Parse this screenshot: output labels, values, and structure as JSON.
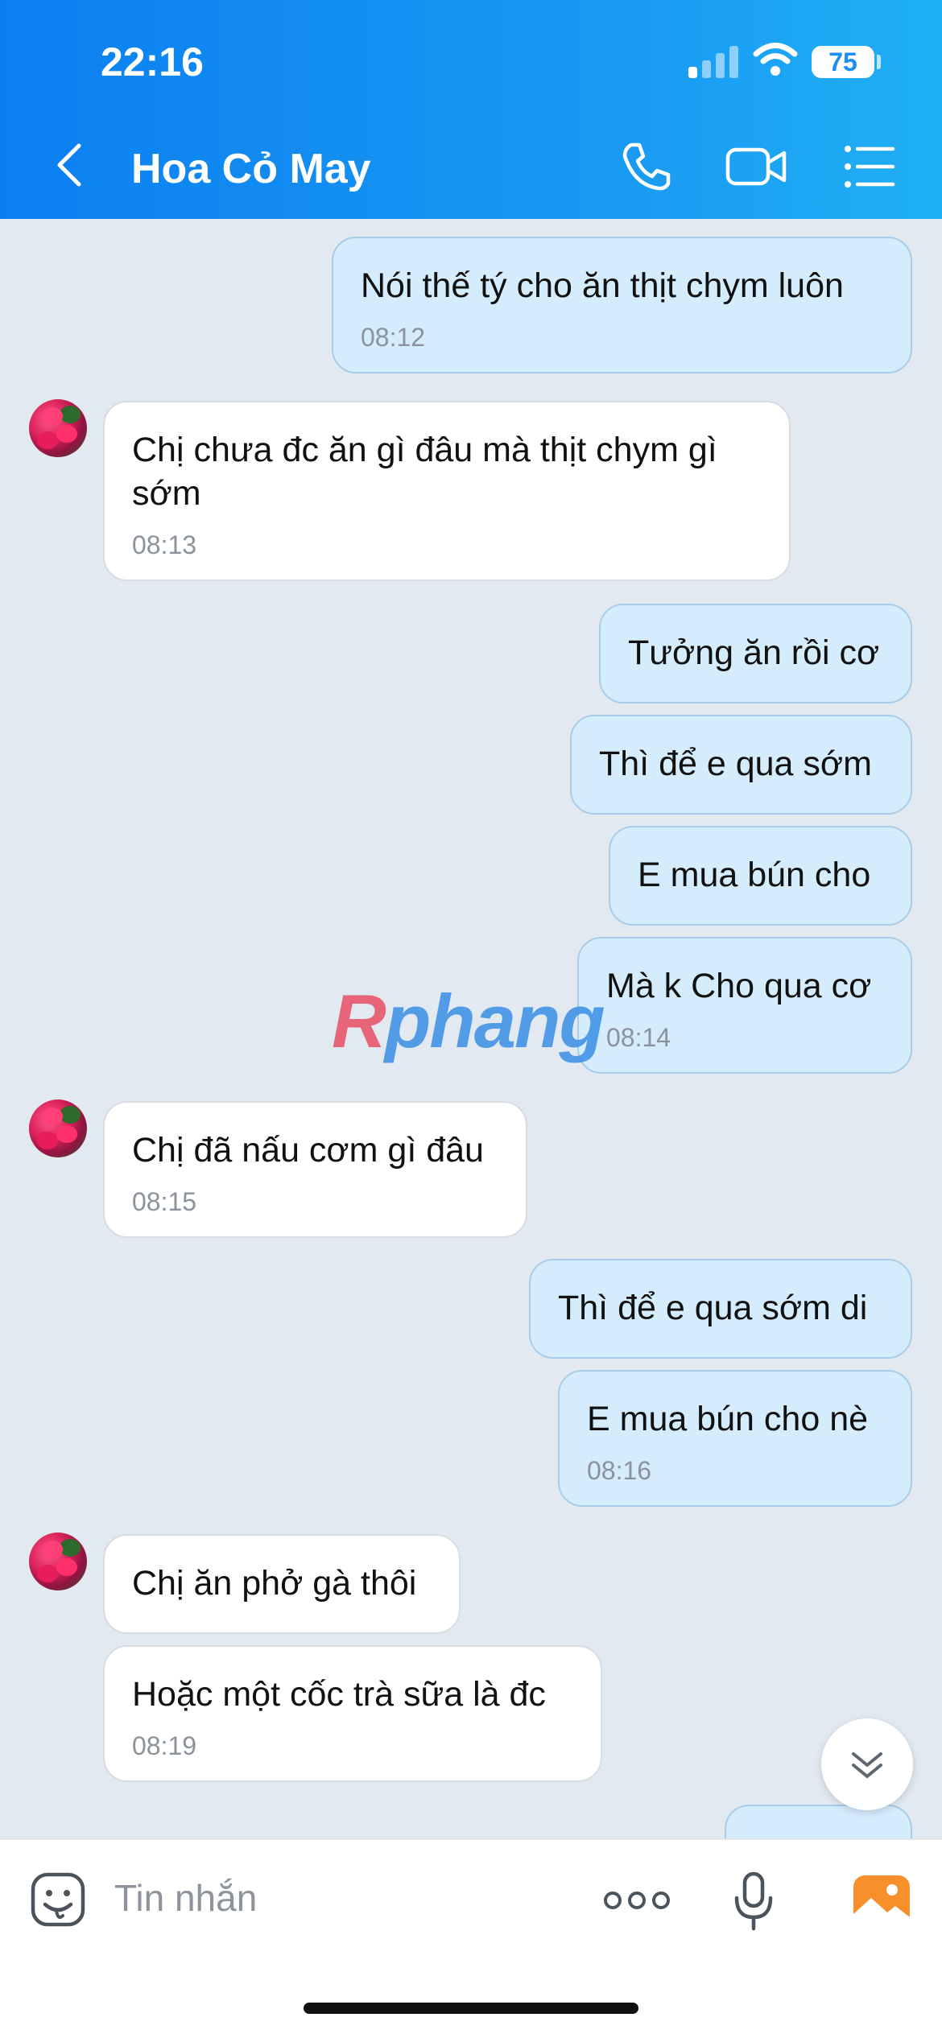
{
  "status_bar": {
    "time": "22:16",
    "battery": "75"
  },
  "header": {
    "title": "Hoa Cỏ May"
  },
  "watermark": {
    "part1": "R",
    "part2": "phang"
  },
  "messages": [
    {
      "dir": "sent",
      "text": "Nói thế tý cho ăn thịt chym luôn",
      "time": "08:12"
    },
    {
      "dir": "recv",
      "text": "Chị chưa đc ăn gì đâu mà thịt chym gì\nsớm",
      "time": "08:13"
    },
    {
      "dir": "sent",
      "text": "Tưởng ăn rồi cơ",
      "time": ""
    },
    {
      "dir": "sent",
      "text": "Thì để e qua sớm",
      "time": ""
    },
    {
      "dir": "sent",
      "text": "E mua bún cho",
      "time": ""
    },
    {
      "dir": "sent",
      "text": "Mà k Cho qua cơ",
      "time": "08:14"
    },
    {
      "dir": "recv",
      "text": "Chị đã nấu cơm gì đâu",
      "time": "08:15"
    },
    {
      "dir": "sent",
      "text": "Thì để e qua sớm di",
      "time": ""
    },
    {
      "dir": "sent",
      "text": "E mua bún cho nè",
      "time": "08:16"
    },
    {
      "dir": "recv",
      "text": "Chị ăn phở gà thôi",
      "time": ""
    },
    {
      "dir": "recv",
      "text": "Hoặc một cốc trà sữa là đc",
      "time": "08:19"
    }
  ],
  "input": {
    "placeholder": "Tin nhắn"
  },
  "icons": {
    "back": "chevron-left-icon",
    "call": "phone-icon",
    "video": "video-camera-icon",
    "menu": "list-menu-icon",
    "sticker": "sticker-face-icon",
    "more": "more-dots-icon",
    "mic": "microphone-icon",
    "image": "image-gallery-icon",
    "scroll": "double-chevron-down-icon"
  },
  "colors": {
    "header": "#0b7ff0",
    "sent_bubble": "#d5ecfd",
    "recv_bubble": "#ffffff",
    "background": "#e2e9f1",
    "image_icon": "#f7902a"
  }
}
